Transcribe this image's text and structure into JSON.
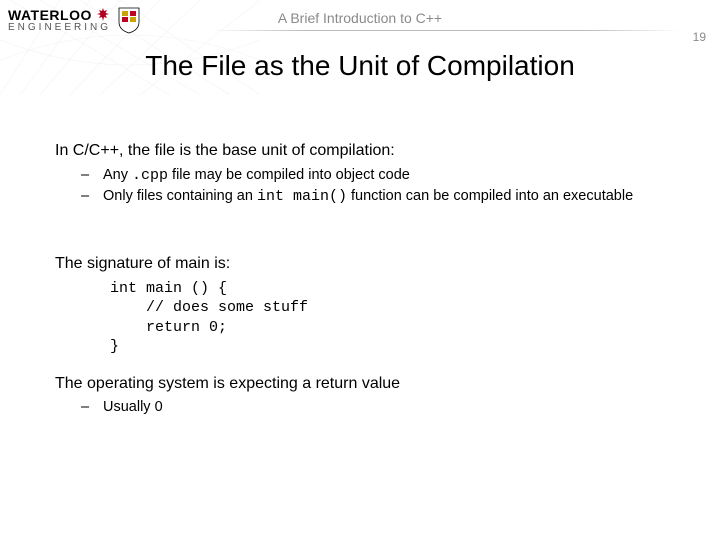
{
  "header": {
    "subtitle": "A Brief Introduction to C++",
    "page_number": "19",
    "logo": {
      "word": "WATERLOO",
      "sub": "ENGINEERING"
    }
  },
  "title": "The File as the Unit of Compilation",
  "body": {
    "p1": "In C/C++, the file is the base unit of compilation:",
    "b1a_pre": "Any ",
    "b1a_code": ".cpp",
    "b1a_post": " file may be compiled into object code",
    "b1b_pre": "Only files containing an ",
    "b1b_code": "int main()",
    "b1b_post": " function can be compiled into an executable",
    "p2": "The signature of main is:",
    "code": "int main () {\n    // does some stuff\n    return 0;\n}",
    "p3": "The operating system is expecting a return value",
    "b3a": "Usually 0"
  }
}
